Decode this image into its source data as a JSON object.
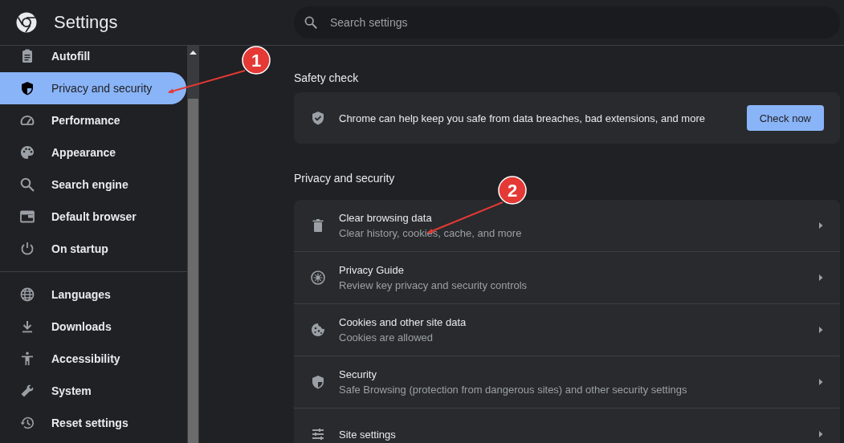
{
  "header": {
    "title": "Settings",
    "search": {
      "placeholder": "Search settings"
    }
  },
  "sidebar": {
    "items": [
      {
        "label": "Autofill",
        "selected": false
      },
      {
        "label": "Privacy and security",
        "selected": true
      },
      {
        "label": "Performance",
        "selected": false
      },
      {
        "label": "Appearance",
        "selected": false
      },
      {
        "label": "Search engine",
        "selected": false
      },
      {
        "label": "Default browser",
        "selected": false
      },
      {
        "label": "On startup",
        "selected": false,
        "divider_after": true
      },
      {
        "label": "Languages",
        "selected": false
      },
      {
        "label": "Downloads",
        "selected": false
      },
      {
        "label": "Accessibility",
        "selected": false
      },
      {
        "label": "System",
        "selected": false
      },
      {
        "label": "Reset settings",
        "selected": false
      }
    ]
  },
  "safety_check": {
    "heading": "Safety check",
    "text": "Chrome can help keep you safe from data breaches, bad extensions, and more",
    "button": "Check now"
  },
  "privacy": {
    "heading": "Privacy and security",
    "rows": [
      {
        "title": "Clear browsing data",
        "subtitle": "Clear history, cookies, cache, and more"
      },
      {
        "title": "Privacy Guide",
        "subtitle": "Review key privacy and security controls"
      },
      {
        "title": "Cookies and other site data",
        "subtitle": "Cookies are allowed"
      },
      {
        "title": "Security",
        "subtitle": "Safe Browsing (protection from dangerous sites) and other security settings"
      },
      {
        "title": "Site settings"
      }
    ]
  },
  "annotations": [
    {
      "label": "1"
    },
    {
      "label": "2"
    }
  ]
}
